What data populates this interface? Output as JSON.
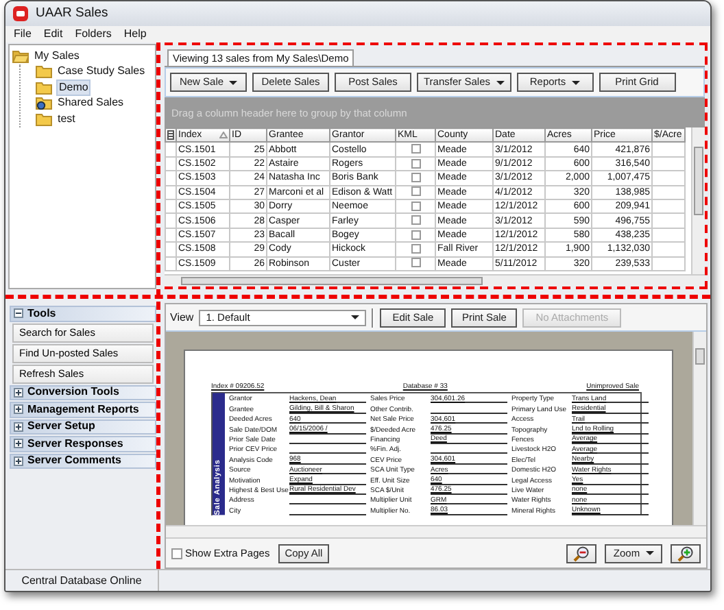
{
  "window": {
    "title": "UAAR Sales"
  },
  "menu": [
    "File",
    "Edit",
    "Folders",
    "Help"
  ],
  "tree": [
    {
      "label": "My Sales",
      "kind": "folder",
      "expanded": true,
      "selected": false,
      "children": [
        {
          "label": "Case Study Sales",
          "kind": "folder",
          "selected": false
        },
        {
          "label": "Demo",
          "kind": "folder",
          "selected": true
        },
        {
          "label": "Shared Sales",
          "kind": "shared",
          "selected": false
        },
        {
          "label": "test",
          "kind": "folder",
          "selected": false
        }
      ]
    }
  ],
  "sales_panel": {
    "tab": {
      "label": "Viewing 13 sales from My Sales\\Demo",
      "selected": true
    },
    "toolbar": [
      {
        "label": "New Sale",
        "dropdown": true
      },
      {
        "label": "Delete Sales",
        "dropdown": false
      },
      {
        "label": "Post Sales",
        "dropdown": false
      },
      {
        "label": "Transfer Sales",
        "dropdown": true
      },
      {
        "label": "Reports",
        "dropdown": true
      },
      {
        "label": "Print Grid",
        "dropdown": false
      }
    ],
    "group_hint": "Drag a column header here to group by that column",
    "table": {
      "columns": [
        {
          "label": "Index",
          "kind": "text",
          "sorted": true
        },
        {
          "label": "ID",
          "kind": "number",
          "sorted": false
        },
        {
          "label": "Grantee",
          "kind": "text",
          "sorted": false
        },
        {
          "label": "Grantor",
          "kind": "text",
          "sorted": false
        },
        {
          "label": "KML",
          "kind": "check",
          "sorted": false
        },
        {
          "label": "County",
          "kind": "text",
          "sorted": false
        },
        {
          "label": "Date",
          "kind": "text",
          "sorted": false
        },
        {
          "label": "Acres",
          "kind": "number",
          "sorted": false
        },
        {
          "label": "Price",
          "kind": "number",
          "sorted": false
        },
        {
          "label": "$/Acre",
          "kind": "number",
          "sorted": false
        }
      ],
      "rows": [
        {
          "cells": [
            "CS.1501",
            "25",
            "Abbott",
            "Costello",
            "",
            "Meade",
            "3/1/2012",
            "640",
            "421,876"
          ],
          "kml": false
        },
        {
          "cells": [
            "CS.1502",
            "22",
            "Astaire",
            "Rogers",
            "",
            "Meade",
            "9/1/2012",
            "600",
            "316,540"
          ],
          "kml": false
        },
        {
          "cells": [
            "CS.1503",
            "24",
            "Natasha Inc",
            "Boris Bank",
            "",
            "Meade",
            "3/1/2012",
            "2,000",
            "1,007,475"
          ],
          "kml": false
        },
        {
          "cells": [
            "CS.1504",
            "27",
            "Marconi et al",
            "Edison & Watt",
            "",
            "Meade",
            "4/1/2012",
            "320",
            "138,985"
          ],
          "kml": false
        },
        {
          "cells": [
            "CS.1505",
            "30",
            "Dorry",
            "Neemoe",
            "",
            "Meade",
            "12/1/2012",
            "600",
            "209,941"
          ],
          "kml": false
        },
        {
          "cells": [
            "CS.1506",
            "28",
            "Casper",
            "Farley",
            "",
            "Meade",
            "3/1/2012",
            "590",
            "496,755"
          ],
          "kml": false
        },
        {
          "cells": [
            "CS.1507",
            "23",
            "Bacall",
            "Bogey",
            "",
            "Meade",
            "12/1/2012",
            "580",
            "438,235"
          ],
          "kml": false
        },
        {
          "cells": [
            "CS.1508",
            "29",
            "Cody",
            "Hickock",
            "",
            "Fall River",
            "12/1/2012",
            "1,900",
            "1,132,030"
          ],
          "kml": false
        },
        {
          "cells": [
            "CS.1509",
            "26",
            "Robinson",
            "Custer",
            "",
            "Meade",
            "5/11/2012",
            "320",
            "239,533"
          ],
          "kml": false
        }
      ]
    }
  },
  "tools_panel": {
    "groups": [
      {
        "title": "Tools",
        "expanded": true,
        "items": [
          "Search for Sales",
          "Find Un-posted Sales",
          "Refresh Sales"
        ]
      },
      {
        "title": "Conversion Tools",
        "expanded": false
      },
      {
        "title": "Management Reports",
        "expanded": false
      },
      {
        "title": "Server Setup",
        "expanded": false
      },
      {
        "title": "Server Responses",
        "expanded": false
      },
      {
        "title": "Server Comments",
        "expanded": false
      }
    ]
  },
  "detail_panel": {
    "view_label": "View",
    "view": "1. Default",
    "buttons": [
      {
        "label": "Edit Sale",
        "disabled": false
      },
      {
        "label": "Print Sale",
        "disabled": false
      },
      {
        "label": "No Attachments",
        "disabled": true
      }
    ],
    "document": {
      "index": "Index # 09206.52",
      "database": "Database # 33",
      "sale_type": "Unimproved Sale",
      "section": "Sale Analysis",
      "columns": [
        [
          {
            "label": "Grantor",
            "value": "Hackens, Dean"
          },
          {
            "label": "Grantee",
            "value": "Gilding, Bill & Sharon"
          },
          {
            "label": "Deeded Acres",
            "value": "640"
          },
          {
            "label": "Sale Date/DOM",
            "value": "06/15/2006 /"
          },
          {
            "label": "Prior Sale Date"
          },
          {
            "label": "Prior CEV Price"
          },
          {
            "label": "Analysis Code",
            "value": "968"
          },
          {
            "label": "Source",
            "value": "Auctioneer"
          },
          {
            "label": "Motivation",
            "value": "Expand"
          },
          {
            "label": "Highest & Best Use",
            "value": "Rural Residential Dev"
          },
          {
            "label": "Address"
          },
          {
            "label": "City"
          }
        ],
        [
          {
            "label": "Sales Price",
            "value": "304,601.26"
          },
          {
            "label": "Other Contrib."
          },
          {
            "label": "Net Sale Price",
            "value": "304,601"
          },
          {
            "label": "$/Deeded Acre",
            "value": "476.25"
          },
          {
            "label": "Financing",
            "value": "Deed"
          },
          {
            "label": "%Fin. Adj."
          },
          {
            "label": "CEV Price",
            "value": "304,601"
          },
          {
            "label": "SCA Unit Type",
            "value": "Acres"
          },
          {
            "label": "Eff. Unit Size",
            "value": "640"
          },
          {
            "label": "SCA $/Unit",
            "value": "476.25"
          },
          {
            "label": "Multiplier Unit",
            "value": "GRM"
          },
          {
            "label": "Multiplier No.",
            "value": "86.03"
          }
        ],
        [
          {
            "label": "Property Type",
            "value": "Trans Land"
          },
          {
            "label": "Primary Land Use",
            "value": "Residential"
          },
          {
            "label": "Access",
            "value": "Trail"
          },
          {
            "label": "Topography",
            "value": "Lnd to Rolling"
          },
          {
            "label": "Fences",
            "value": "Average"
          },
          {
            "label": "Livestock H2O",
            "value": "Average"
          },
          {
            "label": "Elec/Tel",
            "value": "Nearby"
          },
          {
            "label": "Domestic H2O",
            "value": "Water Rights"
          },
          {
            "label": "Legal Access",
            "value": "Yes"
          },
          {
            "label": "Live Water",
            "value": "none"
          },
          {
            "label": "Water Rights",
            "value": "none"
          },
          {
            "label": "Mineral Rights",
            "value": "Unknown"
          }
        ]
      ]
    },
    "show_extra_pages": {
      "label": "Show Extra Pages",
      "checked": false
    },
    "copy_button": "Copy All",
    "zoom": "Zoom"
  },
  "status_bar": [
    "Central Database Online"
  ]
}
